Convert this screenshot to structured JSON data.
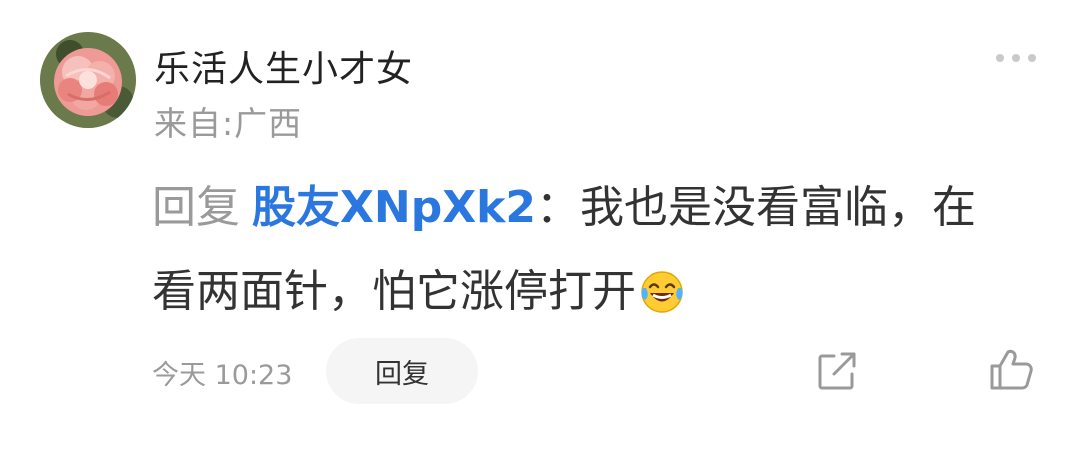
{
  "comment": {
    "username": "乐活人生小才女",
    "location": "来自:广西",
    "reply_prefix": "回复",
    "mention": "股友XNpXk2",
    "body": "：我也是没看富临，在看两面针，怕它涨停打开",
    "emoji": "laughing-tears-emoji",
    "time": "今天 10:23"
  },
  "actions": {
    "reply_label": "回复",
    "more_icon": "more-dots-icon",
    "share_icon": "share-icon",
    "like_icon": "thumbs-up-icon"
  },
  "colors": {
    "mention": "#2a77e0",
    "muted": "#9a9a9a",
    "text": "#333333",
    "reply_button_bg": "#f5f5f5"
  }
}
